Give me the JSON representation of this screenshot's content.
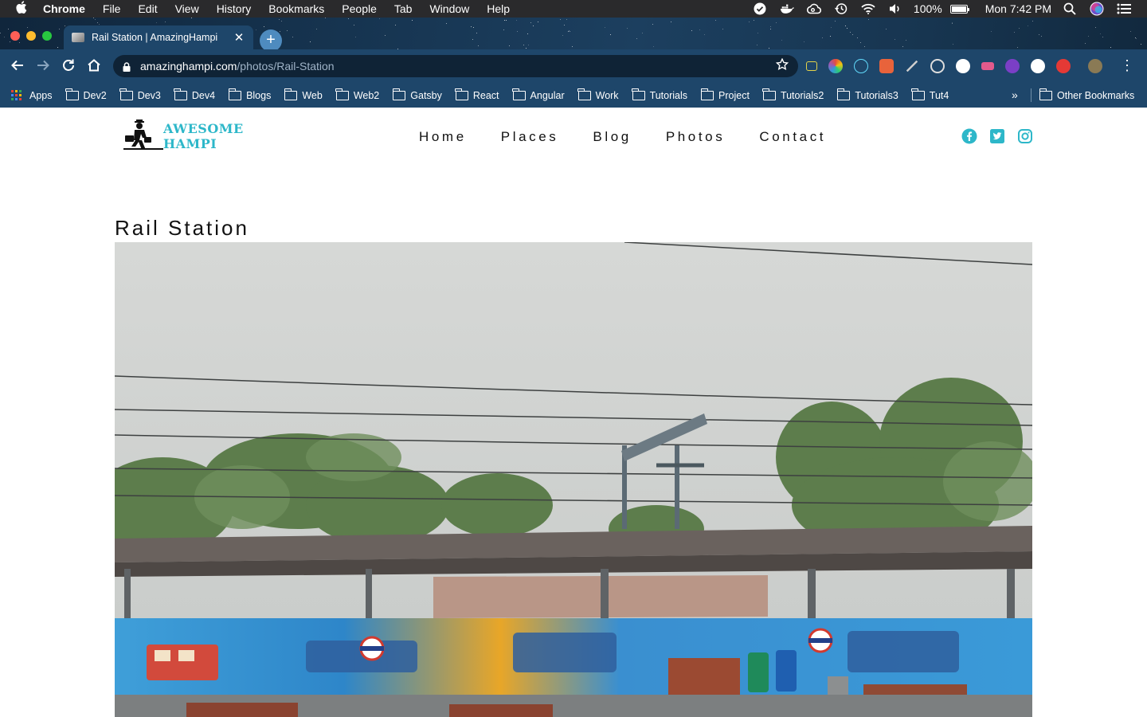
{
  "menubar": {
    "app_name": "Chrome",
    "items": [
      "File",
      "Edit",
      "View",
      "History",
      "Bookmarks",
      "People",
      "Tab",
      "Window",
      "Help"
    ],
    "battery": "100%",
    "battery_level": 1.0,
    "clock": "Mon 7:42 PM"
  },
  "browser": {
    "tab_title": "Rail Station | AmazingHampi",
    "url_host": "amazinghampi.com",
    "url_path": "/photos/Rail-Station",
    "bookmarks": [
      "Apps",
      "Dev2",
      "Dev3",
      "Dev4",
      "Blogs",
      "Web",
      "Web2",
      "Gatsby",
      "React",
      "Angular",
      "Work",
      "Tutorials",
      "Project",
      "Tutorials2",
      "Tutorials3",
      "Tut4"
    ],
    "more_bookmarks": "»",
    "other_bookmarks": "Other Bookmarks"
  },
  "site": {
    "logo_line1": "AWESOME",
    "logo_line2": "HAMPI",
    "nav": [
      "Home",
      "Places",
      "Blog",
      "Photos",
      "Contact"
    ],
    "accent_color": "#2db7c9",
    "socials": [
      "facebook-icon",
      "twitter-icon",
      "instagram-icon"
    ]
  },
  "content": {
    "title": "Rail Station"
  }
}
